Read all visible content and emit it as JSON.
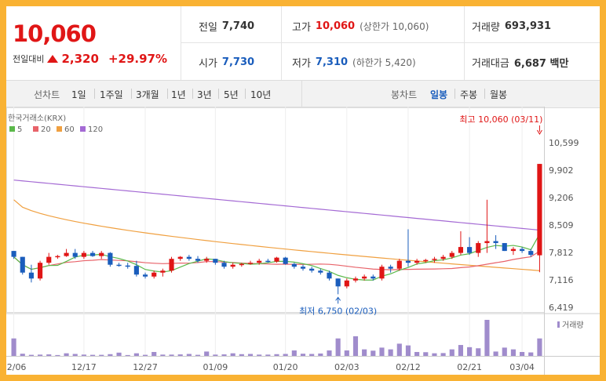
{
  "header": {
    "current_price": "10,060",
    "change_label": "전일대비",
    "change_value": "2,320",
    "change_pct": "+29.97%",
    "prev_close_label": "전일",
    "prev_close": "7,740",
    "open_label": "시가",
    "open": "7,730",
    "high_label": "고가",
    "high": "10,060",
    "upper_limit": "(상한가 10,060)",
    "low_label": "저가",
    "low": "7,310",
    "lower_limit": "(하한가 5,420)",
    "volume_label": "거래량",
    "volume": "693,931",
    "amount_label": "거래대금",
    "amount": "6,687 백만"
  },
  "period": {
    "line_label": "선차트",
    "line_options": [
      "1일",
      "1주일",
      "3개월",
      "1년",
      "3년",
      "5년",
      "10년"
    ],
    "candle_label": "봉차트",
    "candle_options": [
      "일봉",
      "주봉",
      "월봉"
    ],
    "active": "일봉"
  },
  "colors": {
    "up": "#e01616",
    "down": "#1a5dbc",
    "ma5": "#5bb94a",
    "ma20": "#e8636a",
    "ma60": "#f0a040",
    "ma120": "#a46ad4",
    "volume": "#a08ccc"
  },
  "chart_data": {
    "type": "candlestick",
    "source_label": "한국거래소(KRX)",
    "legend": [
      "5",
      "20",
      "60",
      "120"
    ],
    "y_ticks": [
      "10,599",
      "9,902",
      "9,206",
      "8,509",
      "7,812",
      "7,116",
      "6,419"
    ],
    "ylim": [
      6419,
      10599
    ],
    "x_ticks": [
      "12/06",
      "12/17",
      "12/27",
      "01/09",
      "01/20",
      "02/03",
      "02/12",
      "02/21",
      "03/04"
    ],
    "x_tick_index": [
      0,
      8,
      15,
      23,
      31,
      38,
      45,
      52,
      58
    ],
    "volume_label": "거래량",
    "high_annotation": "최고 10,060 (03/11)",
    "low_annotation": "최저 6,750 (02/03)",
    "ohlc": [
      [
        7850,
        7850,
        7650,
        7700
      ],
      [
        7700,
        7700,
        7250,
        7300
      ],
      [
        7300,
        7500,
        7050,
        7150
      ],
      [
        7150,
        7600,
        7100,
        7550
      ],
      [
        7550,
        7800,
        7500,
        7700
      ],
      [
        7700,
        7750,
        7650,
        7720
      ],
      [
        7720,
        7900,
        7700,
        7800
      ],
      [
        7800,
        7900,
        7650,
        7700
      ],
      [
        7700,
        7850,
        7650,
        7800
      ],
      [
        7800,
        7850,
        7700,
        7720
      ],
      [
        7720,
        7850,
        7650,
        7800
      ],
      [
        7800,
        7820,
        7450,
        7500
      ],
      [
        7500,
        7550,
        7450,
        7480
      ],
      [
        7480,
        7550,
        7400,
        7470
      ],
      [
        7470,
        7600,
        7200,
        7250
      ],
      [
        7250,
        7300,
        7150,
        7200
      ],
      [
        7200,
        7350,
        7150,
        7300
      ],
      [
        7300,
        7400,
        7200,
        7350
      ],
      [
        7350,
        7700,
        7300,
        7650
      ],
      [
        7650,
        7720,
        7600,
        7700
      ],
      [
        7700,
        7750,
        7600,
        7650
      ],
      [
        7650,
        7720,
        7550,
        7600
      ],
      [
        7600,
        7700,
        7550,
        7650
      ],
      [
        7650,
        7650,
        7500,
        7550
      ],
      [
        7550,
        7600,
        7400,
        7450
      ],
      [
        7450,
        7550,
        7400,
        7500
      ],
      [
        7500,
        7550,
        7450,
        7520
      ],
      [
        7520,
        7600,
        7500,
        7550
      ],
      [
        7550,
        7650,
        7500,
        7600
      ],
      [
        7600,
        7650,
        7550,
        7580
      ],
      [
        7580,
        7700,
        7550,
        7680
      ],
      [
        7680,
        7700,
        7500,
        7520
      ],
      [
        7520,
        7550,
        7400,
        7450
      ],
      [
        7450,
        7500,
        7350,
        7400
      ],
      [
        7400,
        7450,
        7300,
        7350
      ],
      [
        7350,
        7400,
        7250,
        7300
      ],
      [
        7300,
        7350,
        7100,
        7150
      ],
      [
        7150,
        7150,
        6750,
        6950
      ],
      [
        6950,
        7150,
        6900,
        7100
      ],
      [
        7100,
        7200,
        7050,
        7150
      ],
      [
        7150,
        7250,
        7100,
        7200
      ],
      [
        7200,
        7250,
        7100,
        7150
      ],
      [
        7150,
        7500,
        7100,
        7450
      ],
      [
        7450,
        7500,
        7300,
        7400
      ],
      [
        7400,
        7650,
        7350,
        7600
      ],
      [
        7600,
        8400,
        7450,
        7550
      ],
      [
        7550,
        7650,
        7500,
        7600
      ],
      [
        7600,
        7650,
        7550,
        7620
      ],
      [
        7620,
        7700,
        7550,
        7650
      ],
      [
        7650,
        7750,
        7600,
        7700
      ],
      [
        7700,
        7850,
        7650,
        7800
      ],
      [
        7800,
        8350,
        7750,
        7950
      ],
      [
        7950,
        8200,
        7750,
        7800
      ],
      [
        7800,
        8100,
        7700,
        8050
      ],
      [
        8050,
        9150,
        7800,
        8100
      ],
      [
        8100,
        8250,
        7900,
        8050
      ],
      [
        8050,
        8050,
        7850,
        7850
      ],
      [
        7850,
        7950,
        7750,
        7900
      ],
      [
        7900,
        7950,
        7800,
        7850
      ],
      [
        7850,
        7900,
        7700,
        7750
      ],
      [
        7740,
        10060,
        7310,
        10060
      ]
    ],
    "volume": [
      8000,
      1000,
      500,
      600,
      700,
      400,
      1200,
      900,
      600,
      500,
      500,
      800,
      1500,
      400,
      1200,
      500,
      1800,
      600,
      600,
      700,
      900,
      500,
      2000,
      600,
      700,
      1200,
      800,
      900,
      600,
      600,
      800,
      900,
      2500,
      1000,
      900,
      1100,
      2500,
      8000,
      2500,
      9000,
      3000,
      2400,
      3800,
      3000,
      5600,
      4800,
      1800,
      1700,
      1200,
      1300,
      3000,
      5000,
      4000,
      3500,
      16500,
      2000,
      3800,
      3000,
      1800,
      1600,
      8000
    ]
  }
}
